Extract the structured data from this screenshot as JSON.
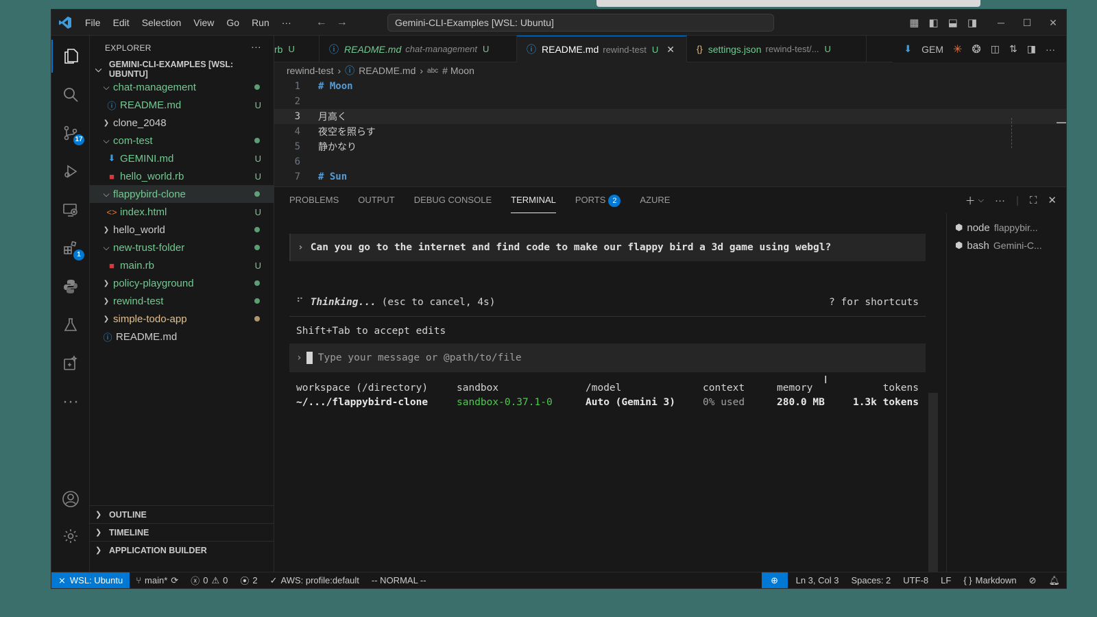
{
  "window": {
    "menu": [
      "File",
      "Edit",
      "Selection",
      "View",
      "Go",
      "Run",
      "···"
    ],
    "command_center": "Gemini-CLI-Examples [WSL: Ubuntu]"
  },
  "activity_bar": {
    "source_control_badge": "17",
    "extensions_badge": "1",
    "more": "···"
  },
  "sidebar": {
    "title": "EXPLORER",
    "more": "···",
    "root": "GEMINI-CLI-EXAMPLES [WSL: UBUNTU]",
    "items": [
      {
        "name": "chat-management",
        "type": "folder",
        "open": true,
        "depth": 1,
        "status": "dot"
      },
      {
        "name": "README.md",
        "type": "info",
        "depth": 2,
        "status": "U"
      },
      {
        "name": "clone_2048",
        "type": "folder",
        "open": false,
        "depth": 1,
        "status": ""
      },
      {
        "name": "com-test",
        "type": "folder",
        "open": true,
        "depth": 1,
        "status": "dot"
      },
      {
        "name": "GEMINI.md",
        "type": "gemini",
        "depth": 2,
        "status": "U"
      },
      {
        "name": "hello_world.rb",
        "type": "ruby",
        "depth": 2,
        "status": "U"
      },
      {
        "name": "flappybird-clone",
        "type": "folder",
        "open": true,
        "depth": 1,
        "status": "dot",
        "selected": true
      },
      {
        "name": "index.html",
        "type": "html",
        "depth": 2,
        "status": "U"
      },
      {
        "name": "hello_world",
        "type": "folder",
        "open": false,
        "depth": 1,
        "status": "dot"
      },
      {
        "name": "new-trust-folder",
        "type": "folder",
        "open": true,
        "depth": 1,
        "status": "dot"
      },
      {
        "name": "main.rb",
        "type": "ruby",
        "depth": 2,
        "status": "U"
      },
      {
        "name": "policy-playground",
        "type": "folder",
        "open": false,
        "depth": 1,
        "status": "dot"
      },
      {
        "name": "rewind-test",
        "type": "folder",
        "open": false,
        "depth": 1,
        "status": "dot"
      },
      {
        "name": "simple-todo-app",
        "type": "folder",
        "open": false,
        "depth": 1,
        "status": "dot-orange"
      },
      {
        "name": "README.md",
        "type": "info",
        "depth": 1,
        "status": ""
      }
    ],
    "sections": [
      "OUTLINE",
      "TIMELINE",
      "APPLICATION BUILDER"
    ]
  },
  "editor": {
    "tabs": [
      {
        "file": "rb",
        "desc": "",
        "u": "U"
      },
      {
        "file": "README.md",
        "desc": "chat-management",
        "u": "U"
      },
      {
        "file": "README.md",
        "desc": "rewind-test",
        "u": "U",
        "active": true
      },
      {
        "file": "settings.json",
        "desc": "rewind-test/...",
        "u": "U"
      }
    ],
    "tab_actions": {
      "gem": "GEM",
      "more": "···"
    },
    "breadcrumb": [
      "rewind-test",
      "README.md",
      "# Moon"
    ],
    "lines": [
      {
        "n": "1",
        "text": "# Moon",
        "heading": true
      },
      {
        "n": "2",
        "text": ""
      },
      {
        "n": "3",
        "text": "月高く",
        "current": true
      },
      {
        "n": "4",
        "text": "夜空を照らす"
      },
      {
        "n": "5",
        "text": "静かなり"
      },
      {
        "n": "6",
        "text": ""
      },
      {
        "n": "7",
        "text": "# Sun",
        "heading": true
      }
    ]
  },
  "panel": {
    "tabs": [
      "PROBLEMS",
      "OUTPUT",
      "DEBUG CONSOLE",
      "TERMINAL",
      "PORTS",
      "AZURE"
    ],
    "active_tab": "TERMINAL",
    "ports_badge": "2",
    "terminal": {
      "prompt": "Can you go to the internet and find code to make our flappy bird a 3d game using webgl?",
      "thinking_label": "Thinking...",
      "thinking_detail": "(esc to cancel, 4s)",
      "shortcuts": "? for shortcuts",
      "hint": "Shift+Tab to accept edits",
      "input_placeholder": "Type your message or @path/to/file",
      "status_headers": [
        "workspace (/directory)",
        "sandbox",
        "/model",
        "context",
        "memory",
        "tokens"
      ],
      "status_values": [
        "~/.../flappybird-clone",
        "sandbox-0.37.1-0",
        "Auto (Gemini 3)",
        "0% used",
        "280.0 MB",
        "1.3k tokens"
      ]
    },
    "terminal_list": [
      {
        "name": "node",
        "sub": "flappybir..."
      },
      {
        "name": "bash",
        "sub": "Gemini-C..."
      }
    ]
  },
  "statusbar": {
    "remote": "WSL: Ubuntu",
    "branch": "main*",
    "errors": "0",
    "warnings": "0",
    "ports": "2",
    "aws": "AWS: profile:default",
    "vim_mode": "-- NORMAL --",
    "position": "Ln 3, Col 3",
    "spaces": "Spaces: 2",
    "encoding": "UTF-8",
    "eol": "LF",
    "language": "Markdown"
  },
  "colors": {
    "accent": "#0078d4",
    "untracked": "#73c991",
    "modified_dot": "#e2c08d",
    "sandbox_green": "#4ec94e"
  }
}
